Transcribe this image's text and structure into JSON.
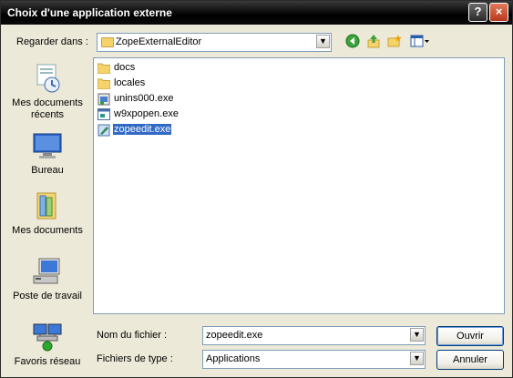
{
  "window": {
    "title": "Choix d'une application externe"
  },
  "titlebar": {
    "help_label": "?",
    "close_label": "×"
  },
  "lookin": {
    "label": "Regarder dans :",
    "value": "ZopeExternalEditor",
    "arrow": "▼"
  },
  "toolbar": {
    "back_icon": "back-arrow-icon",
    "up_icon": "up-folder-icon",
    "new_folder_icon": "new-folder-icon",
    "view_icon": "view-menu-icon"
  },
  "places": [
    {
      "label": "Mes documents récents",
      "icon": "recent-documents-icon"
    },
    {
      "label": "Bureau",
      "icon": "desktop-icon"
    },
    {
      "label": "Mes documents",
      "icon": "my-documents-icon"
    },
    {
      "label": "Poste de travail",
      "icon": "my-computer-icon"
    },
    {
      "label": "Favoris réseau",
      "icon": "network-places-icon"
    }
  ],
  "files": [
    {
      "name": "docs",
      "type": "folder"
    },
    {
      "name": "locales",
      "type": "folder"
    },
    {
      "name": "unins000.exe",
      "type": "exe"
    },
    {
      "name": "w9xpopen.exe",
      "type": "exe"
    },
    {
      "name": "zopeedit.exe",
      "type": "exe",
      "selected": true
    }
  ],
  "filename": {
    "label": "Nom du fichier :",
    "value": "zopeedit.exe"
  },
  "filetype": {
    "label": "Fichiers de type :",
    "value": "Applications"
  },
  "buttons": {
    "open": "Ouvrir",
    "cancel": "Annuler"
  },
  "colors": {
    "selection": "#316ac5",
    "titlebar": "#000000",
    "dialog_bg": "#ece9d8"
  }
}
